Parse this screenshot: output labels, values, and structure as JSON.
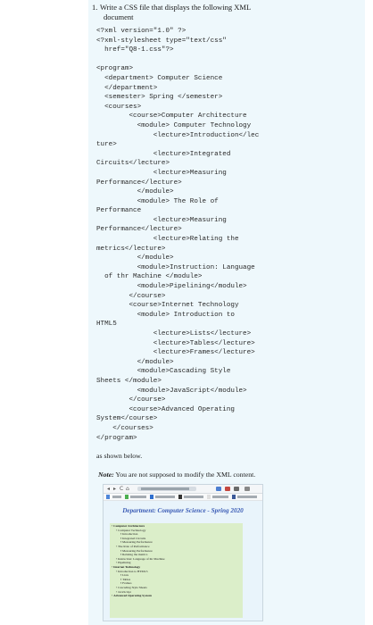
{
  "question": {
    "number": "1.",
    "line1": "Write a CSS file that displays the following XML",
    "line2": "document"
  },
  "code_lines": [
    "<?xml version=\"1.0\" ?>",
    "<?xml-stylesheet type=\"text/css\"",
    "  href=\"Q8-1.css\"?>",
    "",
    "<program>",
    "  <department> Computer Science",
    "  </department>",
    "  <semester> Spring </semester>",
    "  <courses>",
    "        <course>Computer Architecture",
    "          <module> Computer Technology",
    "              <lecture>Introduction</lec",
    "ture>",
    "              <lecture>Integrated",
    "Circuits</lecture>",
    "              <lecture>Measuring",
    "Performance</lecture>",
    "          </module>",
    "          <module> The Role of",
    "Performance",
    "              <lecture>Measuring",
    "Performance</lecture>",
    "              <lecture>Relating the",
    "metrics</lecture>",
    "          </module>",
    "          <module>Instruction: Language",
    "  of thr Machine </module>",
    "          <module>Pipelining</module>",
    "        </course>",
    "        <course>Internet Technology",
    "          <module> Introduction to",
    "HTML5",
    "              <lecture>Lists</lecture>",
    "              <lecture>Tables</lecture>",
    "              <lecture>Frames</lecture>",
    "          </module>",
    "          <module>Cascading Style",
    "Sheets </module>",
    "          <module>JavaScript</module>",
    "        </course>",
    "        <course>Advanced Operating",
    "System</course>",
    "    </courses>",
    "</program>"
  ],
  "shown_below": "as shown below.",
  "note": {
    "label": "Note:",
    "text": " You are not supposed to modify the XML content."
  },
  "browser": {
    "nav_back": "◂",
    "nav_forward": "▸",
    "nav_reload": "C",
    "nav_home": "⌂",
    "heading": "Department: Computer Science - Spring 2020",
    "heading_color": "#3a5bb5",
    "content_bg": "#dbeec9",
    "page_bg": "#e9f4fb",
    "tree": [
      {
        "level": 0,
        "text": "Computer Architecture",
        "bold": true
      },
      {
        "level": 1,
        "text": "Computer Technology",
        "bold": false
      },
      {
        "level": 2,
        "text": "Introduction",
        "bold": false
      },
      {
        "level": 2,
        "text": "Integrated Circuits",
        "bold": false
      },
      {
        "level": 2,
        "text": "Measuring Performance",
        "bold": false
      },
      {
        "level": 1,
        "text": "The Role of Performance",
        "bold": false
      },
      {
        "level": 2,
        "text": "Measuring Performance",
        "bold": false
      },
      {
        "level": 2,
        "text": "Relating the metrics",
        "bold": false
      },
      {
        "level": 1,
        "text": "Instruction: Language of thr Machine",
        "bold": false
      },
      {
        "level": 1,
        "text": "Pipelining",
        "bold": false
      },
      {
        "level": 0,
        "text": "Internet Technology",
        "bold": true
      },
      {
        "level": 1,
        "text": "Introduction to HTML5",
        "bold": false
      },
      {
        "level": 2,
        "text": "Lists",
        "bold": false
      },
      {
        "level": 2,
        "text": "Tables",
        "bold": false
      },
      {
        "level": 2,
        "text": "Frames",
        "bold": false
      },
      {
        "level": 1,
        "text": "Cascading Style Sheets",
        "bold": false
      },
      {
        "level": 1,
        "text": "JavaScript",
        "bold": false
      },
      {
        "level": 0,
        "text": "Advanced Operating System",
        "bold": true
      }
    ]
  }
}
